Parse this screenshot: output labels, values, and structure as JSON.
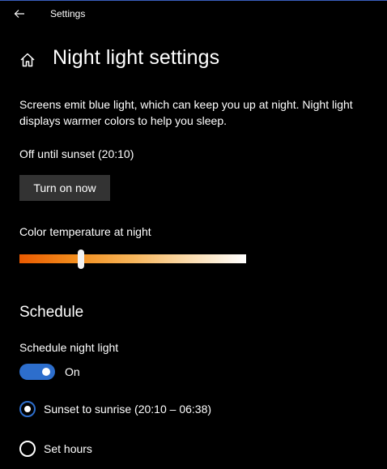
{
  "window": {
    "title": "Settings"
  },
  "page": {
    "title": "Night light settings",
    "description": "Screens emit blue light, which can keep you up at night. Night light displays warmer colors to help you sleep.",
    "status": "Off until sunset (20:10)",
    "turn_on_label": "Turn on now"
  },
  "color_temperature": {
    "label": "Color temperature at night",
    "value_fraction": 0.27,
    "gradient_colors": [
      "#ea5a00",
      "#f28e1e",
      "#f7b55a",
      "#fbdcae",
      "#ffffff"
    ]
  },
  "schedule": {
    "title": "Schedule",
    "toggle_label": "Schedule night light",
    "toggle_state": "On",
    "toggle_on": true,
    "options": [
      {
        "label": "Sunset to sunrise (20:10 – 06:38)",
        "selected": true
      },
      {
        "label": "Set hours",
        "selected": false
      }
    ]
  },
  "colors": {
    "background": "#000000",
    "accent": "#2d6ecc",
    "button": "#333333",
    "text": "#ffffff"
  },
  "icons": {
    "back": "back-arrow-icon",
    "home": "home-icon"
  }
}
